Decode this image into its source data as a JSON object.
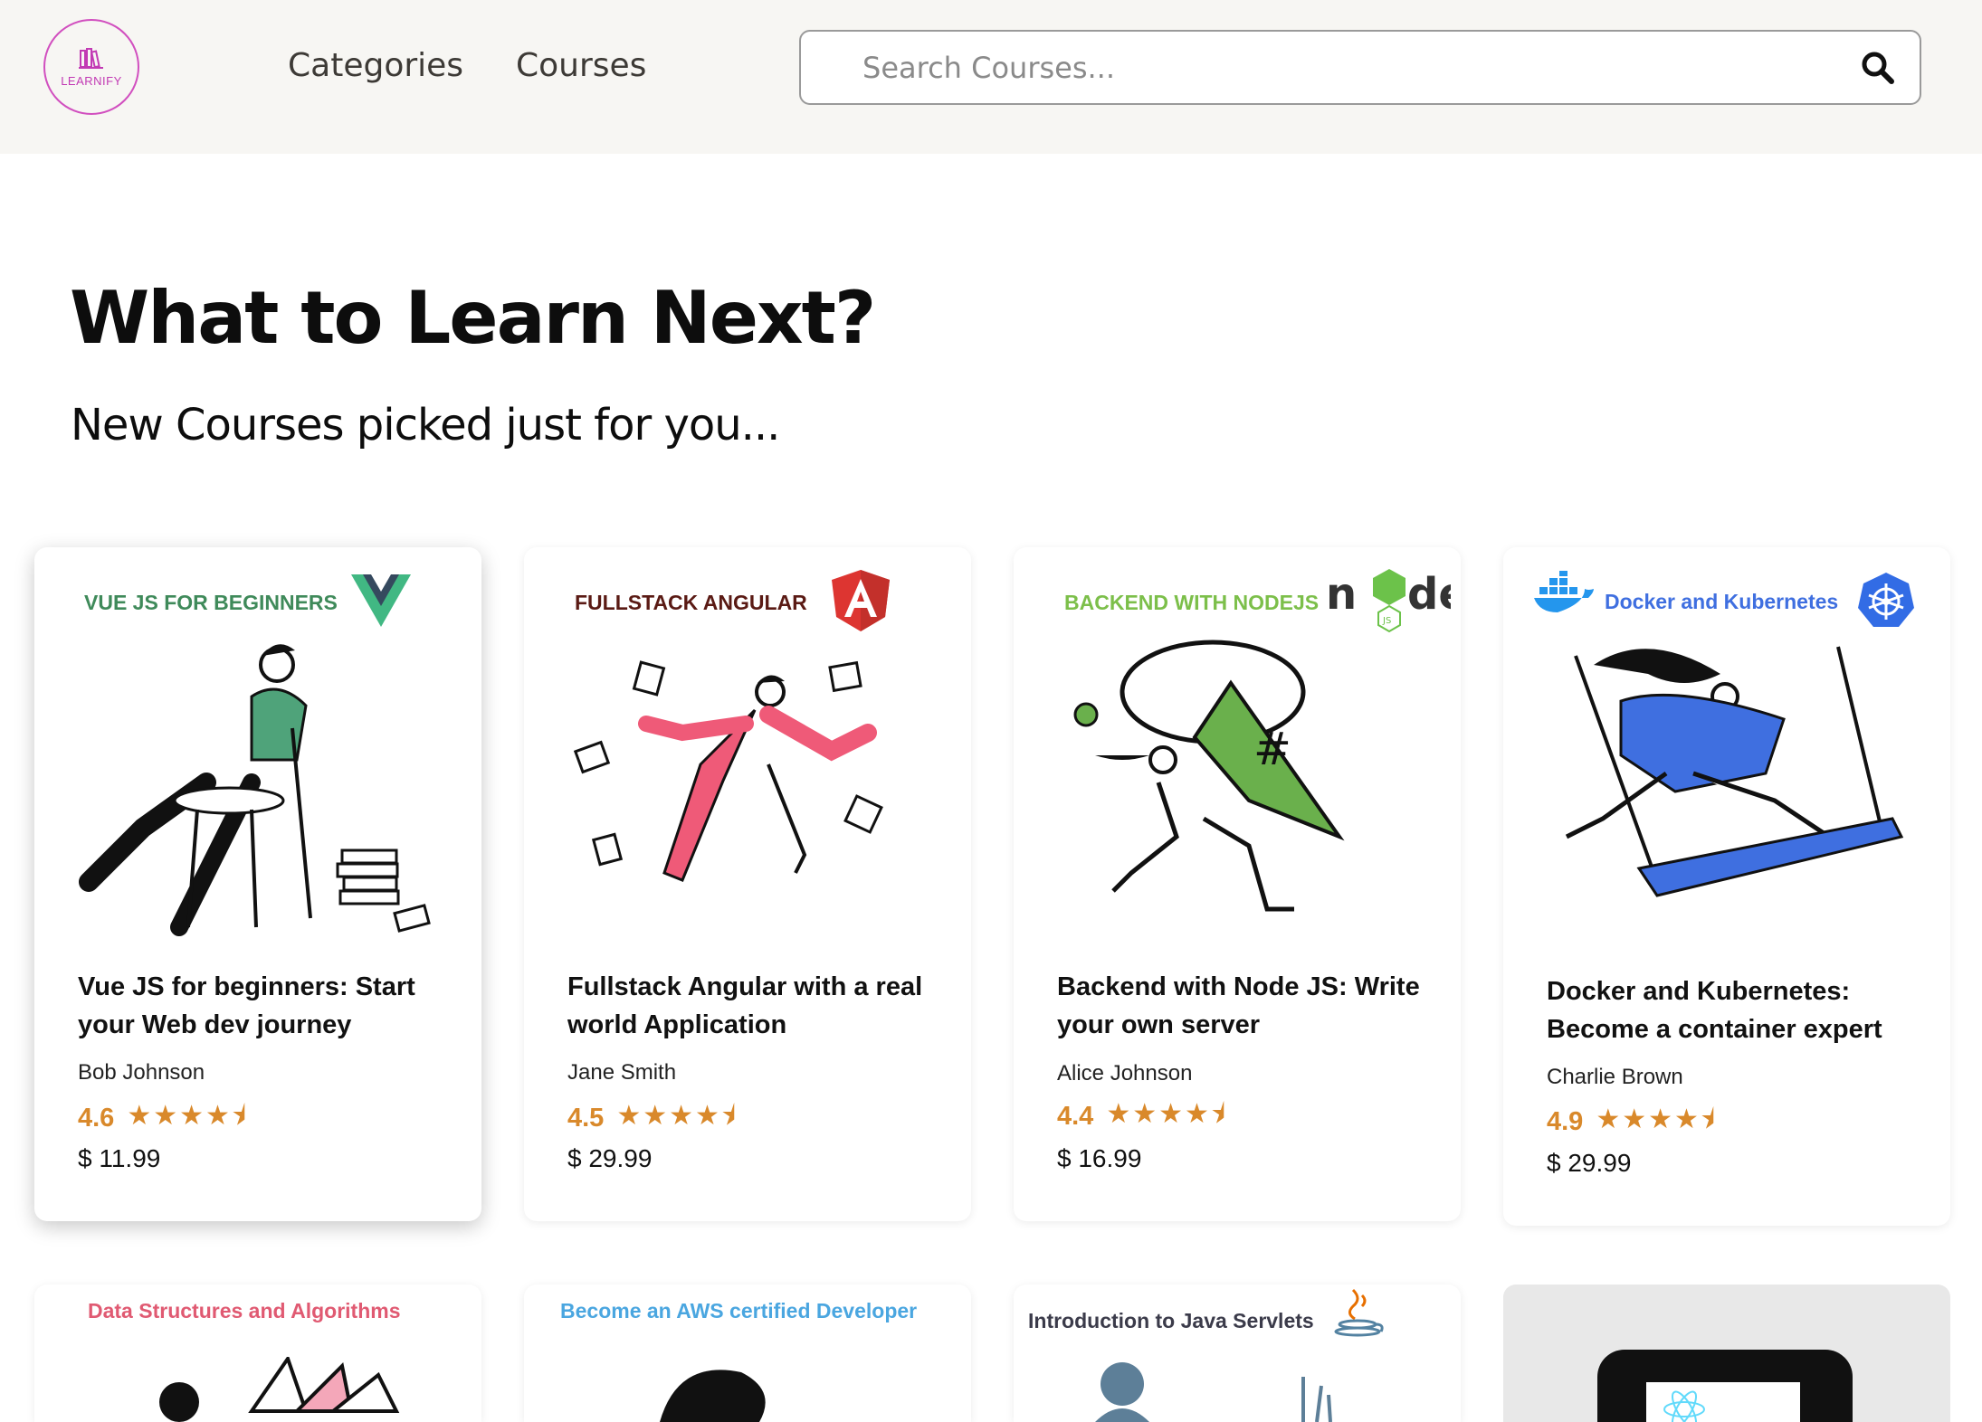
{
  "header": {
    "logo_text": "LEARNIFY",
    "nav": [
      "Categories",
      "Courses"
    ],
    "search_placeholder": "Search Courses..."
  },
  "main": {
    "title": "What to Learn Next?",
    "subtitle": "New Courses picked just for you..."
  },
  "courses": [
    {
      "tag": "VUE JS FOR BEGINNERS",
      "tag_color": "#3f8a5a",
      "logo": "vue-logo-icon",
      "title": "Vue JS for beginners: Start your Web dev journey",
      "author": "Bob Johnson",
      "rating": "4.6",
      "stars": "★★★★⯨",
      "price": "$ 11.99"
    },
    {
      "tag": "FULLSTACK ANGULAR",
      "tag_color": "#5a1a14",
      "logo": "angular-logo-icon",
      "title": "Fullstack Angular with a real world Application",
      "author": "Jane Smith",
      "rating": "4.5",
      "stars": "★★★★⯨",
      "price": "$ 29.99"
    },
    {
      "tag": "BACKEND WITH NODEJS",
      "tag_color": "#7cbf4a",
      "logo": "nodejs-logo-icon",
      "title": "Backend with Node JS: Write your own server",
      "author": "Alice Johnson",
      "rating": "4.4",
      "stars": "★★★★⯨",
      "price": "$ 16.99"
    },
    {
      "tag": "Docker and Kubernetes",
      "tag_color": "#3f6fe0",
      "logo": "kubernetes-logo-icon",
      "title": "Docker and Kubernetes: Become a container expert",
      "author": "Charlie Brown",
      "rating": "4.9",
      "stars": "★★★★⯨",
      "price": "$ 29.99"
    }
  ],
  "more_courses": [
    {
      "tag": "Data Structures and Algorithms",
      "tag_color": "#e05a72"
    },
    {
      "tag": "Become an AWS certified Developer",
      "tag_color": "#4aa6e0"
    },
    {
      "tag": "Introduction to Java Servlets",
      "tag_color": "#3b3b4a"
    }
  ],
  "colors": {
    "accent": "#d9892b",
    "header_bg": "#f7f6f3",
    "logo": "#c23ab4"
  }
}
